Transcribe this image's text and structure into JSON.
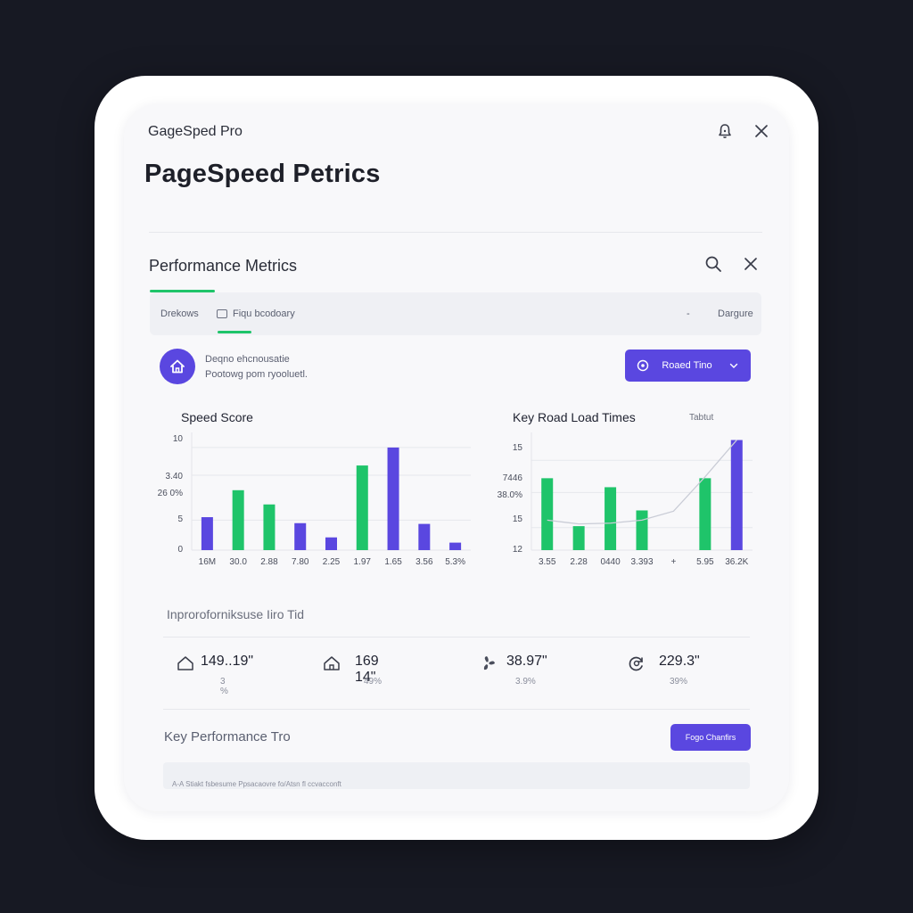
{
  "app": {
    "name": "GageSped Pro",
    "title": "PageSpeed Petrics"
  },
  "header_icons": {
    "bell": "bell-icon",
    "close": "close-icon"
  },
  "section": {
    "title": "Performance Metrics",
    "icons": {
      "search": "search-icon",
      "close": "close-icon"
    }
  },
  "tabs": [
    {
      "label": "Drekows"
    },
    {
      "label": "Fiqu bcodoary"
    }
  ],
  "tab_right": {
    "dash": "-",
    "label": "Dargure"
  },
  "info": {
    "line1": "Deqno ehcnousatie",
    "line2": "Pootowg pom ryooluetl.",
    "button_label": "Roaed Tino"
  },
  "colors": {
    "accent": "#5a47e0",
    "green": "#1fc46a",
    "background": "#171923"
  },
  "chart_data": [
    {
      "type": "bar",
      "title": "Speed Score",
      "y_tick_labels": [
        "10",
        "3.40",
        "26 0%",
        "5",
        "0"
      ],
      "categories": [
        "16M",
        "30.0",
        "2.88",
        "7.80",
        "2.25",
        "1.97",
        "1.65",
        "3.56",
        "5.3%"
      ],
      "series": [
        {
          "color": "#5a47e0",
          "values": [
            4.4,
            null,
            null,
            3.6,
            1.7,
            null,
            13.7,
            3.5,
            1.0
          ]
        },
        {
          "color": "#1fc46a",
          "values": [
            null,
            8.0,
            6.1,
            null,
            null,
            11.3,
            null,
            null,
            null
          ]
        }
      ],
      "ylim": [
        0,
        15
      ]
    },
    {
      "type": "bar",
      "title": "Key Road Load Times",
      "legend_label": "Tabtut",
      "y_tick_labels": [
        "15",
        "7446",
        "38.0%",
        "15",
        "12"
      ],
      "categories": [
        "3.55",
        "2.28",
        "0440",
        "3.393",
        "+",
        "5.95",
        "36.2K"
      ],
      "series": [
        {
          "color": "#1fc46a",
          "values": [
            9.6,
            3.2,
            8.4,
            5.3,
            null,
            9.6,
            null
          ]
        },
        {
          "color": "#5a47e0",
          "values": [
            null,
            null,
            null,
            null,
            null,
            null,
            14.7
          ]
        }
      ],
      "trend_line": true,
      "ylim": [
        0,
        15
      ]
    }
  ],
  "improvements": {
    "title": "Inproroforniksuse Iiro Tid",
    "stats": [
      {
        "icon": "home-icon",
        "value": "149..19\"",
        "pct": "3 %"
      },
      {
        "icon": "home-icon",
        "value": "169 14\"",
        "pct": "49%"
      },
      {
        "icon": "fan-icon",
        "value": "38.97\"",
        "pct": "3.9%"
      },
      {
        "icon": "refresh-icon",
        "value": "229.3\"",
        "pct": "39%"
      }
    ]
  },
  "key_performance": {
    "title": "Key Performance Tro",
    "button_label": "Fogo Chanfirs",
    "strip_text": "A-A  Stiakt fsbesume Ppsacaovre fo/Atsn fl ccvacconft"
  }
}
